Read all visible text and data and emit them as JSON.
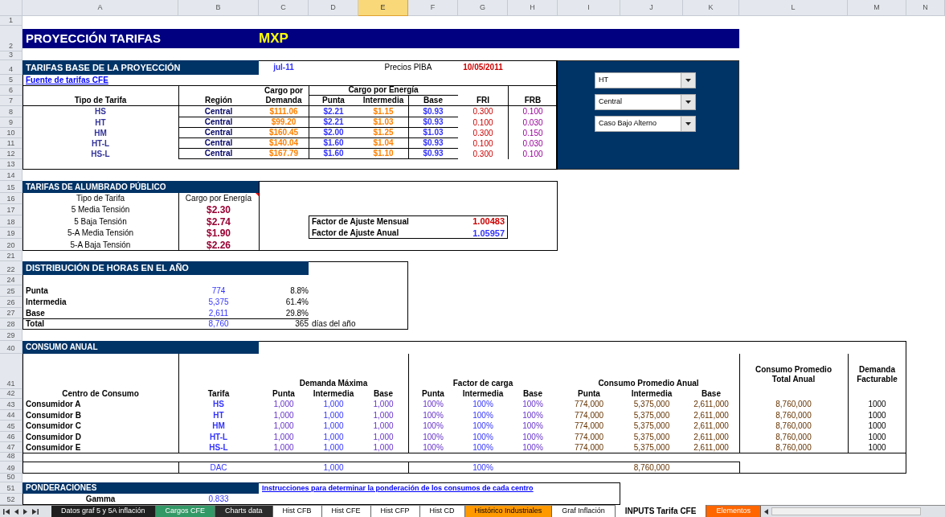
{
  "columns": [
    {
      "label": "A",
      "selected": false
    },
    {
      "label": "B",
      "selected": false
    },
    {
      "label": "C",
      "selected": false
    },
    {
      "label": "D",
      "selected": false
    },
    {
      "label": "E",
      "selected": true
    },
    {
      "label": "F",
      "selected": false
    },
    {
      "label": "G",
      "selected": false
    },
    {
      "label": "H",
      "selected": false
    },
    {
      "label": "I",
      "selected": false
    },
    {
      "label": "J",
      "selected": false
    },
    {
      "label": "K",
      "selected": false
    },
    {
      "label": "L",
      "selected": false
    },
    {
      "label": "M",
      "selected": false
    },
    {
      "label": "N",
      "selected": false
    }
  ],
  "row_headers": [
    "1",
    "2",
    "3",
    "4",
    "5",
    "6",
    "7",
    "8",
    "9",
    "10",
    "11",
    "12",
    "13",
    "14",
    "15",
    "16",
    "17",
    "18",
    "19",
    "20",
    "21",
    "22",
    "24",
    "25",
    "26",
    "27",
    "28",
    "29",
    "40",
    "41",
    "42",
    "43",
    "44",
    "45",
    "46",
    "47",
    "48",
    "49",
    "50",
    "51",
    "52"
  ],
  "title": "PROYECCIÓN TARIFAS",
  "currency": "MXP",
  "tarifas_base": {
    "title": "TARIFAS BASE DE LA PROYECCIÓN",
    "month": "jul-11",
    "price_label": "Precios PIBA",
    "date": "10/05/2011",
    "link": "Fuente de tarifas CFE",
    "header_demanda_1": "Cargo por",
    "header_demanda_2": "Demanda",
    "header_energia": "Cargo por Energía",
    "headers": [
      "Tipo de Tarifa",
      "Región",
      "Punta",
      "Intermedia",
      "Base",
      "FRI",
      "FRB"
    ],
    "rows": [
      {
        "tipo": "HS",
        "region": "Central",
        "demanda": "$111.06",
        "punta": "$2.21",
        "intermedia": "$1.15",
        "base": "$0.93",
        "fri": "0.300",
        "frb": "0.100"
      },
      {
        "tipo": "HT",
        "region": "Central",
        "demanda": "$99.20",
        "punta": "$2.21",
        "intermedia": "$1.03",
        "base": "$0.93",
        "fri": "0.100",
        "frb": "0.030"
      },
      {
        "tipo": "HM",
        "region": "Central",
        "demanda": "$160.45",
        "punta": "$2.00",
        "intermedia": "$1.25",
        "base": "$1.03",
        "fri": "0.300",
        "frb": "0.150"
      },
      {
        "tipo": "HT-L",
        "region": "Central",
        "demanda": "$140.04",
        "punta": "$1.60",
        "intermedia": "$1.04",
        "base": "$0.93",
        "fri": "0.100",
        "frb": "0.030"
      },
      {
        "tipo": "HS-L",
        "region": "Central",
        "demanda": "$167.79",
        "punta": "$1.60",
        "intermedia": "$1.10",
        "base": "$0.93",
        "fri": "0.300",
        "frb": "0.100"
      }
    ]
  },
  "dropdowns": [
    "HT",
    "Central",
    "Caso Bajo Alterno"
  ],
  "alumbrado": {
    "title": "TARIFAS DE ALUMBRADO PÚBLICO",
    "headers": [
      "Tipo de Tarifa",
      "Cargo por Energía"
    ],
    "comment": true,
    "rows": [
      {
        "tipo": "5 Media Tensión",
        "cargo": "$2.30"
      },
      {
        "tipo": "5 Baja Tensión",
        "cargo": "$2.74"
      },
      {
        "tipo": "5-A Media Tensión",
        "cargo": "$1.90"
      },
      {
        "tipo": "5-A Baja Tensión",
        "cargo": "$2.26"
      }
    ]
  },
  "factores": [
    {
      "label": "Factor de Ajuste Mensual",
      "value": "1.00483",
      "color": "#cc0000"
    },
    {
      "label": "Factor de Ajuste Anual",
      "value": "1.05957",
      "color": "#3333ff"
    }
  ],
  "distribucion": {
    "title": "DISTRIBUCIÓN DE HORAS EN EL AÑO",
    "rows": [
      {
        "label": "Punta",
        "hours": "774",
        "share": "8.8%"
      },
      {
        "label": "Intermedia",
        "hours": "5,375",
        "share": "61.4%"
      },
      {
        "label": "Base",
        "hours": "2,611",
        "share": "29.8%"
      }
    ],
    "total": {
      "label": "Total",
      "hours": "8,760",
      "days": "365",
      "days_label": "días del año"
    }
  },
  "consumo": {
    "title": "CONSUMO ANUAL",
    "group_demanda": "Demanda Máxima",
    "group_factor": "Factor de carga",
    "group_consumo": "Consumo Promedio Anual",
    "total_header": "Consumo Promedio Total Anual",
    "facturable_header": "Demanda Facturable",
    "headers": [
      "Centro de Consumo",
      "Tarifa",
      "Punta",
      "Intermedia",
      "Base",
      "Punta",
      "Intermedia",
      "Base",
      "Punta",
      "Intermedia",
      "Base"
    ],
    "rows": [
      {
        "centro": "Consumidor A",
        "tarifa": "HS",
        "dem": [
          "1,000",
          "1,000",
          "1,000"
        ],
        "fc": [
          "100%",
          "100%",
          "100%"
        ],
        "cons": [
          "774,000",
          "5,375,000",
          "2,611,000"
        ],
        "total": "8,760,000",
        "facturable": "1000"
      },
      {
        "centro": "Consumidor B",
        "tarifa": "HT",
        "dem": [
          "1,000",
          "1,000",
          "1,000"
        ],
        "fc": [
          "100%",
          "100%",
          "100%"
        ],
        "cons": [
          "774,000",
          "5,375,000",
          "2,611,000"
        ],
        "total": "8,760,000",
        "facturable": "1000"
      },
      {
        "centro": "Consumidor C",
        "tarifa": "HM",
        "dem": [
          "1,000",
          "1,000",
          "1,000"
        ],
        "fc": [
          "100%",
          "100%",
          "100%"
        ],
        "cons": [
          "774,000",
          "5,375,000",
          "2,611,000"
        ],
        "total": "8,760,000",
        "facturable": "1000"
      },
      {
        "centro": "Consumidor D",
        "tarifa": "HT-L",
        "dem": [
          "1,000",
          "1,000",
          "1,000"
        ],
        "fc": [
          "100%",
          "100%",
          "100%"
        ],
        "cons": [
          "774,000",
          "5,375,000",
          "2,611,000"
        ],
        "total": "8,760,000",
        "facturable": "1000"
      },
      {
        "centro": "Consumidor E",
        "tarifa": "HS-L",
        "dem": [
          "1,000",
          "1,000",
          "1,000"
        ],
        "fc": [
          "100%",
          "100%",
          "100%"
        ],
        "cons": [
          "774,000",
          "5,375,000",
          "2,611,000"
        ],
        "total": "8,760,000",
        "facturable": "1000"
      }
    ],
    "totals": {
      "tarifa": "DAC",
      "dem": "1,000",
      "fc": "100%",
      "cons": "8,760,000"
    }
  },
  "ponderaciones": {
    "title": "PONDERACIONES",
    "link": "Instrucciones para determinar la ponderación de los consumos de cada centro",
    "label": "Gamma",
    "value": "0.833"
  },
  "sheet_tabs": [
    {
      "label": "Datos graf 5 y 5A inflación",
      "selected": false,
      "color": "#1f1f1f"
    },
    {
      "label": "Cargos CFE",
      "selected": false,
      "color": "#339966"
    },
    {
      "label": "Charts data",
      "selected": false,
      "color": "#2b2b2b"
    },
    {
      "label": "Hist CFB",
      "selected": false
    },
    {
      "label": "Hist CFE",
      "selected": false
    },
    {
      "label": "Hist CFP",
      "selected": false
    },
    {
      "label": "Hist CD",
      "selected": false
    },
    {
      "label": "Histórico Industriales",
      "selected": false,
      "color": "#ff9900"
    },
    {
      "label": "Graf Inflación",
      "selected": false
    },
    {
      "label": "INPUTS Tarifa CFE",
      "selected": true
    },
    {
      "label": "Elementos",
      "selected": false,
      "color": "#ff6600"
    }
  ]
}
